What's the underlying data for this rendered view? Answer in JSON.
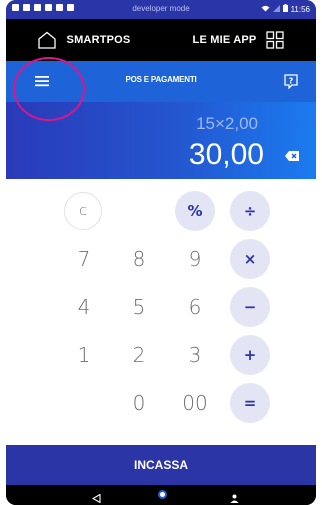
{
  "statusbar": {
    "center": "developer mode",
    "time": "11:56"
  },
  "topbar": {
    "left_label": "SMARTPOS",
    "right_label": "LE MIE APP"
  },
  "header": {
    "title": "POS E PAGAMENTI"
  },
  "display": {
    "expression": "15×2,00",
    "result": "30,00"
  },
  "keypad": {
    "clear": "C",
    "percent": "%",
    "divide": "÷",
    "multiply": "×",
    "minus": "−",
    "plus": "+",
    "equals": "=",
    "digits": [
      "7",
      "8",
      "9",
      "4",
      "5",
      "6",
      "1",
      "2",
      "3",
      "0",
      "00"
    ]
  },
  "action": {
    "label": "INCASSA"
  },
  "colors": {
    "primary": "#2b35a5",
    "header": "#1e63d8",
    "highlight": "#e0148a",
    "op_bg": "#e3e4f4"
  }
}
